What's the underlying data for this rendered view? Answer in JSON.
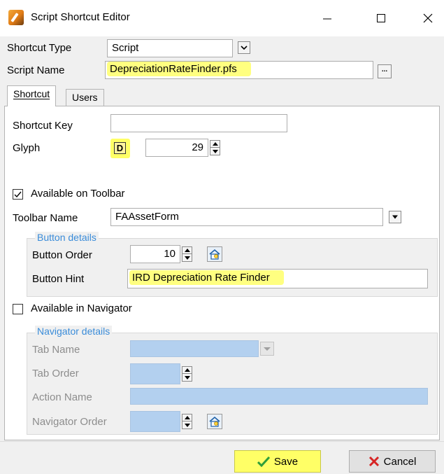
{
  "window": {
    "title": "Script Shortcut Editor"
  },
  "title_buttons": {
    "minimize": "—",
    "maximize": "☐",
    "close": "✕"
  },
  "form": {
    "shortcut_type_label": "Shortcut Type",
    "shortcut_type_value": "Script",
    "script_name_label": "Script Name",
    "script_name_value": "DepreciationRateFinder.pfs",
    "browse_label": "..."
  },
  "tabs": [
    {
      "label": "Shortcut",
      "active": true
    },
    {
      "label": "Users",
      "active": false
    }
  ],
  "shortcut_tab": {
    "shortcut_key_label": "Shortcut Key",
    "shortcut_key_value": "",
    "glyph_label": "Glyph",
    "glyph_letter": "D",
    "glyph_index": "29",
    "available_toolbar_label": "Available on Toolbar",
    "available_toolbar_checked": true,
    "toolbar_name_label": "Toolbar Name",
    "toolbar_name_value": "FAAssetForm",
    "button_details": {
      "title": "Button details",
      "button_order_label": "Button Order",
      "button_order_value": "10",
      "button_hint_label": "Button Hint",
      "button_hint_value": "IRD Depreciation Rate Finder"
    },
    "available_navigator_label": "Available in Navigator",
    "available_navigator_checked": false,
    "navigator_details": {
      "title": "Navigator details",
      "tab_name_label": "Tab Name",
      "tab_order_label": "Tab Order",
      "action_name_label": "Action Name",
      "navigator_order_label": "Navigator Order"
    }
  },
  "footer": {
    "save_label": "Save",
    "cancel_label": "Cancel"
  },
  "colors": {
    "highlight": "#ffff80",
    "group_title": "#3a8cd9",
    "disabled_input": "#b3d0ef"
  }
}
